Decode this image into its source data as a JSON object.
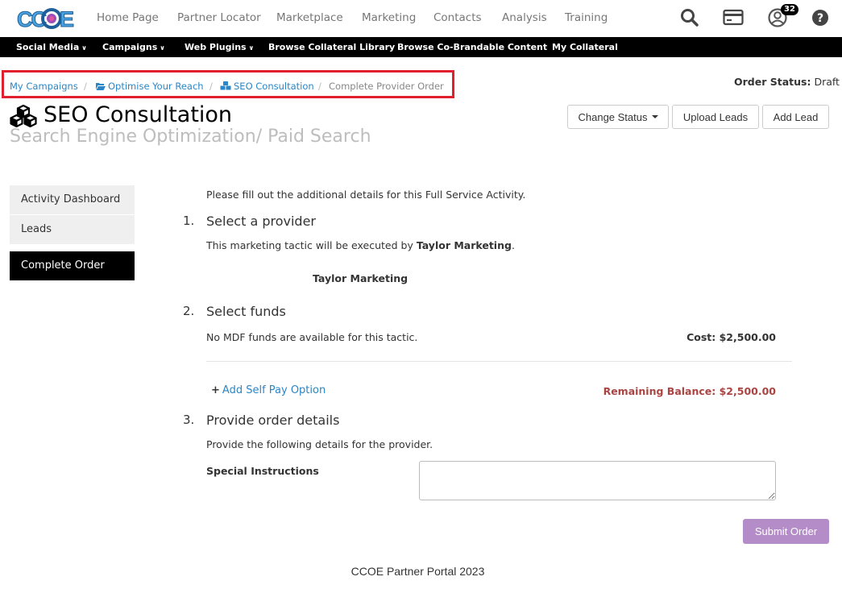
{
  "nav": {
    "items": [
      {
        "label": "Home Page"
      },
      {
        "label": "Partner Locator"
      },
      {
        "label": "Marketplace"
      },
      {
        "label": "Marketing"
      },
      {
        "label": "Contacts"
      },
      {
        "label": "Analysis"
      },
      {
        "label": "Training"
      }
    ],
    "notification_count": "32",
    "icons": [
      "search-icon",
      "credit-card-icon",
      "user-icon",
      "help-icon"
    ]
  },
  "subnav": {
    "items": [
      {
        "label": "Social Media"
      },
      {
        "label": "Campaigns"
      },
      {
        "label": "Web Plugins"
      },
      {
        "label": "Browse Collateral Library"
      },
      {
        "label": "Browse Co-Brandable Content"
      },
      {
        "label": "My Collateral"
      }
    ]
  },
  "breadcrumb": {
    "items": [
      "My Campaigns",
      "Optimise Your Reach",
      "SEO Consultation",
      "Complete Provider Order"
    ],
    "separator": "/"
  },
  "order_status": {
    "label": "Order Status:",
    "value": "Draft"
  },
  "page": {
    "title": "SEO Consultation",
    "subtitle": "Search Engine Optimization/ Paid Search"
  },
  "actions": {
    "change_status": "Change Status",
    "upload_leads": "Upload Leads",
    "add_lead": "Add Lead"
  },
  "sidebar": {
    "items": [
      {
        "label": "Activity Dashboard"
      },
      {
        "label": "Leads"
      },
      {
        "label": "Complete Order"
      }
    ]
  },
  "main": {
    "intro": "Please fill out the additional details for this Full Service Activity.",
    "step1": {
      "num": "1.",
      "title": "Select a provider",
      "desc_prefix": "This marketing tactic will be executed by ",
      "provider": "Taylor Marketing",
      "desc_suffix": ".",
      "provider_card": "Taylor Marketing"
    },
    "step2": {
      "num": "2.",
      "title": "Select funds",
      "no_funds": "No MDF funds are available for this tactic.",
      "cost": "Cost: $2,500.00",
      "add_self_pay": "Add Self Pay Option",
      "remaining": "Remaining Balance: $2,500.00"
    },
    "step3": {
      "num": "3.",
      "title": "Provide order details",
      "desc": "Provide the following details for the provider.",
      "field_label": "Special Instructions"
    },
    "submit": "Submit Order"
  },
  "footer": "CCOE Partner Portal 2023",
  "colors": {
    "link": "#2a86c6",
    "highlight_border": "#e0202e",
    "remaining": "#a94442",
    "submit": "#b48cc8"
  }
}
